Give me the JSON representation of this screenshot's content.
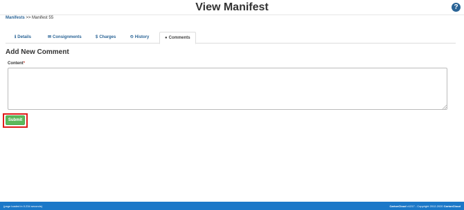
{
  "header": {
    "title": "View Manifest",
    "help_icon": "question-circle-icon",
    "help_glyph": "?"
  },
  "breadcrumb": {
    "link": "Manifests",
    "separator": ">>",
    "current": "Manifest 55"
  },
  "tabs": [
    {
      "label": "Details",
      "icon": "info-icon",
      "glyph": "ℹ",
      "active": false
    },
    {
      "label": "Consignments",
      "icon": "envelope-icon",
      "glyph": "✉",
      "active": false
    },
    {
      "label": "Charges",
      "icon": "dollar-icon",
      "glyph": "$",
      "active": false
    },
    {
      "label": "History",
      "icon": "history-icon",
      "glyph": "⏲",
      "active": false
    },
    {
      "label": "Comments",
      "icon": "comment-icon",
      "glyph": "●",
      "active": true
    }
  ],
  "form": {
    "section_title": "Add New Comment",
    "content_label": "Content",
    "required_marker": "*",
    "content_value": "",
    "submit_label": "Submit"
  },
  "footer": {
    "left_text": "(page loaded in 0.234 seconds)",
    "right_brand": "CartonCloud",
    "right_version": "v1217 - Copyright 2012-2020",
    "right_brand_2": "CartonCloud"
  },
  "colors": {
    "accent_link": "#2a6496",
    "submit_green": "#5cb85c",
    "footer_blue": "#1b78c8",
    "highlight_red": "#e0191a"
  }
}
